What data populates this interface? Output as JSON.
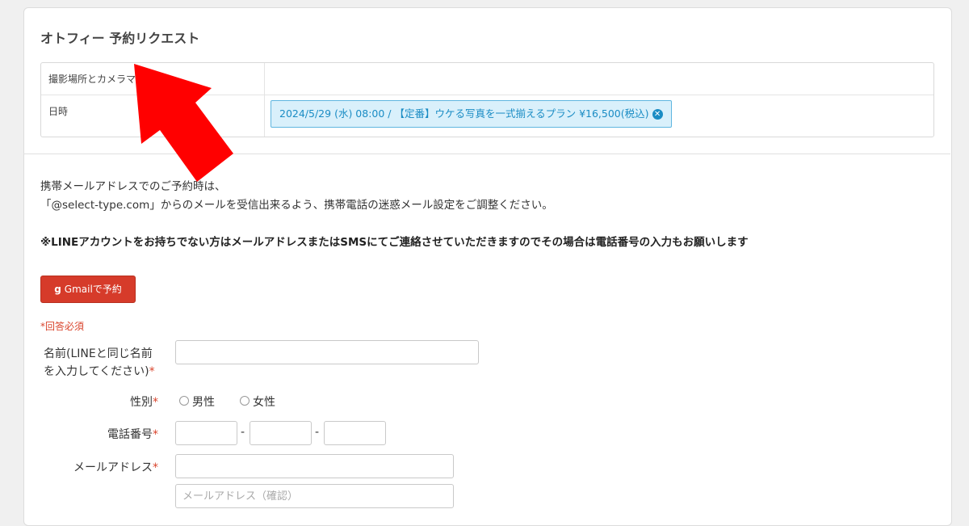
{
  "page": {
    "title": "オトフィー 予約リクエスト"
  },
  "info": {
    "location_label": "撮影場所とカメラマン",
    "datetime_label": "日時",
    "selected_plan": "2024/5/29 (水) 08:00 / 【定番】ウケる写真を一式揃えるプラン ¥16,500(税込)"
  },
  "notice": {
    "line1": "携帯メールアドレスでのご予約時は、",
    "line2": "「@select-type.com」からのメールを受信出来るよう、携帯電話の迷惑メール設定をご調整ください。",
    "bold": "※LINEアカウントをお持ちでない方はメールアドレスまたはSMSにてご連絡させていただきますのでその場合は電話番号の入力もお願いします"
  },
  "gmail_button": {
    "icon": "g",
    "label": "Gmailで予約"
  },
  "form": {
    "required_note": "*回答必須",
    "required_mark": "*",
    "name_label_1": "名前(LINEと同じ名前",
    "name_label_2": "を入力してください)",
    "gender_label": "性別",
    "gender_male": "男性",
    "gender_female": "女性",
    "phone_label": "電話番号",
    "phone_separator": "-",
    "email_label": "メールアドレス",
    "email_confirm_placeholder": "メールアドレス（確認）"
  },
  "colors": {
    "accent_red": "#d63b2a",
    "plan_blue": "#1a8cc4",
    "arrow_red": "#ff0000"
  }
}
